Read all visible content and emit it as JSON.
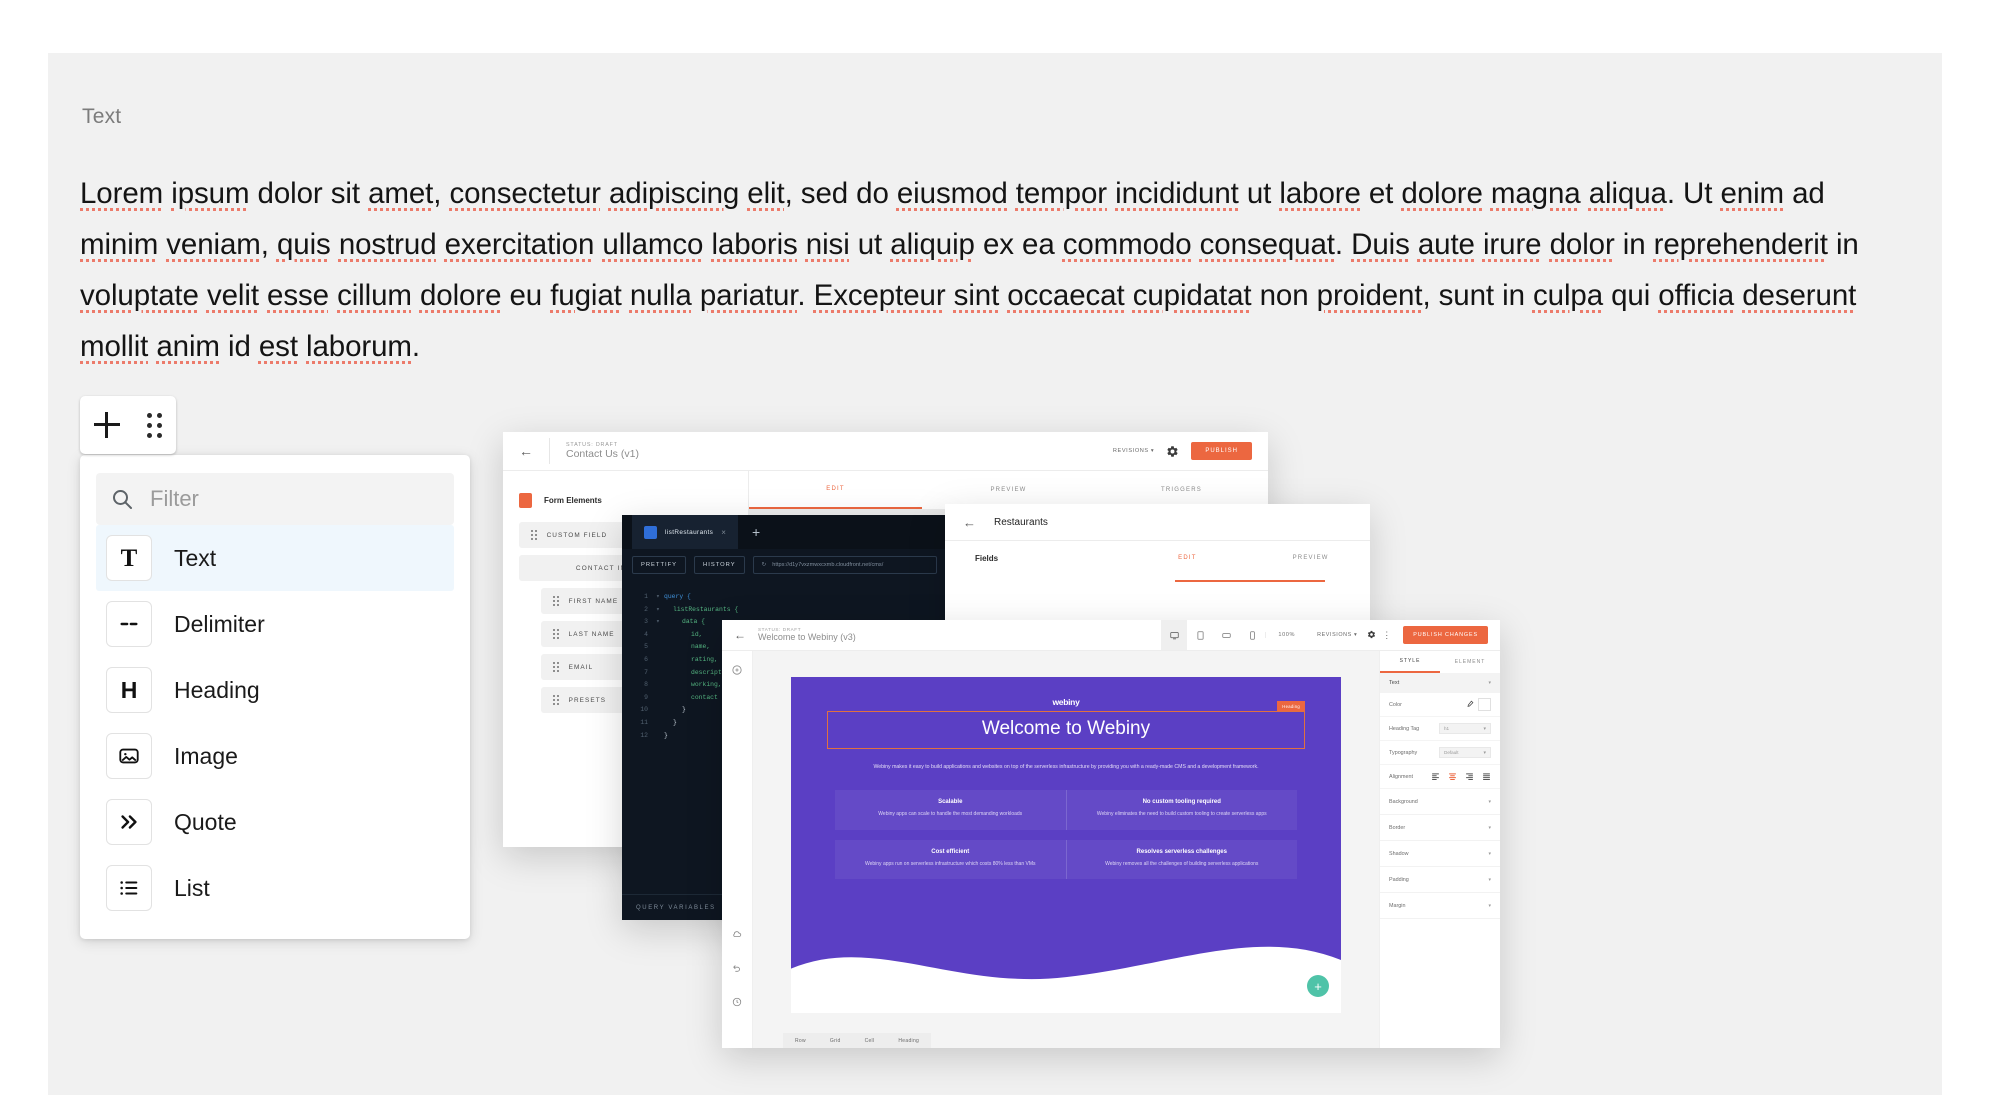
{
  "editor": {
    "block_label": "Text",
    "paragraph_words": [
      {
        "t": "Lorem",
        "sp": true
      },
      {
        "t": " "
      },
      {
        "t": "ipsum",
        "sp": true
      },
      {
        "t": " "
      },
      {
        "t": "dolor"
      },
      {
        "t": " "
      },
      {
        "t": "sit"
      },
      {
        "t": " "
      },
      {
        "t": "amet",
        "sp": true
      },
      {
        "t": ", "
      },
      {
        "t": "consectetur",
        "sp": true
      },
      {
        "t": " "
      },
      {
        "t": "adipiscing",
        "sp": true
      },
      {
        "t": " "
      },
      {
        "t": "elit",
        "sp": true
      },
      {
        "t": ", sed do "
      },
      {
        "t": "eiusmod",
        "sp": true
      },
      {
        "t": " "
      },
      {
        "t": "tempor",
        "sp": true
      },
      {
        "t": " "
      },
      {
        "t": "incididunt",
        "sp": true
      },
      {
        "t": " ut "
      },
      {
        "t": "labore",
        "sp": true
      },
      {
        "t": " et "
      },
      {
        "t": "dolore",
        "sp": true
      },
      {
        "t": " "
      },
      {
        "t": "magna",
        "sp": true
      },
      {
        "t": " "
      },
      {
        "t": "aliqua",
        "sp": true
      },
      {
        "t": ". Ut "
      },
      {
        "t": "enim",
        "sp": true
      },
      {
        "t": " ad "
      },
      {
        "t": "minim",
        "sp": true
      },
      {
        "t": " "
      },
      {
        "t": "veniam",
        "sp": true
      },
      {
        "t": ", "
      },
      {
        "t": "quis",
        "sp": true
      },
      {
        "t": " "
      },
      {
        "t": "nostrud",
        "sp": true
      },
      {
        "t": " "
      },
      {
        "t": "exercitation",
        "sp": true
      },
      {
        "t": " "
      },
      {
        "t": "ullamco",
        "sp": true
      },
      {
        "t": " "
      },
      {
        "t": "laboris",
        "sp": true
      },
      {
        "t": " "
      },
      {
        "t": "nisi",
        "sp": true
      },
      {
        "t": " ut "
      },
      {
        "t": "aliquip",
        "sp": true
      },
      {
        "t": " ex ea "
      },
      {
        "t": "commodo",
        "sp": true
      },
      {
        "t": " "
      },
      {
        "t": "consequat",
        "sp": true
      },
      {
        "t": ". "
      },
      {
        "t": "Duis",
        "sp": true
      },
      {
        "t": " "
      },
      {
        "t": "aute",
        "sp": true
      },
      {
        "t": " "
      },
      {
        "t": "irure",
        "sp": true
      },
      {
        "t": " "
      },
      {
        "t": "dolor",
        "sp": true
      },
      {
        "t": " in "
      },
      {
        "t": "reprehenderit",
        "sp": true
      },
      {
        "t": " "
      },
      {
        "t": "in"
      },
      {
        "t": " "
      },
      {
        "t": "voluptate",
        "sp": true
      },
      {
        "t": " "
      },
      {
        "t": "velit",
        "sp": true
      },
      {
        "t": " "
      },
      {
        "t": "esse",
        "sp": true
      },
      {
        "t": " "
      },
      {
        "t": "cillum",
        "sp": true
      },
      {
        "t": " "
      },
      {
        "t": "dolore",
        "sp": true
      },
      {
        "t": " eu "
      },
      {
        "t": "fugiat",
        "sp": true
      },
      {
        "t": " "
      },
      {
        "t": "nulla",
        "sp": true
      },
      {
        "t": " "
      },
      {
        "t": "pariatur",
        "sp": true
      },
      {
        "t": ". "
      },
      {
        "t": "Excepteur",
        "sp": true
      },
      {
        "t": " "
      },
      {
        "t": "sint",
        "sp": true
      },
      {
        "t": " "
      },
      {
        "t": "occaecat",
        "sp": true
      },
      {
        "t": " "
      },
      {
        "t": "cupidatat",
        "sp": true
      },
      {
        "t": " non "
      },
      {
        "t": "proident",
        "sp": true
      },
      {
        "t": ", sunt in "
      },
      {
        "t": "culpa",
        "sp": true
      },
      {
        "t": " qui "
      },
      {
        "t": "officia",
        "sp": true
      },
      {
        "t": " "
      },
      {
        "t": "deserunt",
        "sp": true
      },
      {
        "t": " "
      },
      {
        "t": "mollit",
        "sp": true
      },
      {
        "t": " "
      },
      {
        "t": "anim",
        "sp": true
      },
      {
        "t": " id "
      },
      {
        "t": "est",
        "sp": true
      },
      {
        "t": " "
      },
      {
        "t": "laborum",
        "sp": true
      },
      {
        "t": "."
      }
    ]
  },
  "add_bar": {
    "plus_label": "+",
    "drag_label": "drag-handle"
  },
  "block_picker": {
    "filter_placeholder": "Filter",
    "filter_value": "",
    "options": [
      {
        "label": "Text",
        "glyph": "T",
        "icon": "text-icon",
        "selected": true
      },
      {
        "label": "Delimiter",
        "glyph": "--",
        "icon": "delimiter-icon",
        "selected": false
      },
      {
        "label": "Heading",
        "glyph": "H",
        "icon": "heading-icon",
        "selected": false
      },
      {
        "label": "Image",
        "glyph": "",
        "icon": "image-icon",
        "selected": false
      },
      {
        "label": "Quote",
        "glyph": "»",
        "icon": "quote-icon",
        "selected": false
      },
      {
        "label": "List",
        "glyph": "",
        "icon": "list-icon",
        "selected": false
      }
    ]
  },
  "screenshots": {
    "form_editor": {
      "status": "STATUS: DRAFT",
      "title": "Contact Us",
      "version": "(v1)",
      "revisions": "REVISIONS",
      "publish": "PUBLISH",
      "sidebar_title": "Form Elements",
      "custom_field": "CUSTOM FIELD",
      "group_label": "CONTACT INFORMATION",
      "fields": [
        "FIRST NAME",
        "LAST NAME",
        "EMAIL",
        "PRESETS"
      ],
      "tabs": [
        "EDIT",
        "PREVIEW",
        "TRIGGERS"
      ],
      "active_tab": "EDIT"
    },
    "graphql": {
      "tab_name": "listRestaurants",
      "new_tab": "+",
      "prettify": "PRETTIFY",
      "history": "HISTORY",
      "url": "https://d1y7vxzmwxcxmb.cloudfront.net/cms/",
      "query_variables": "QUERY VARIABLES",
      "code": [
        {
          "n": "1",
          "fold": "▾",
          "text": "query {",
          "indent": 0,
          "kw": true
        },
        {
          "n": "2",
          "fold": "▾",
          "text": "listRestaurants {",
          "indent": 1,
          "fn": true
        },
        {
          "n": "3",
          "fold": "▾",
          "text": "data {",
          "indent": 2,
          "fn": true
        },
        {
          "n": "4",
          "fold": "",
          "text": "id,",
          "indent": 3,
          "fn": true
        },
        {
          "n": "5",
          "fold": "",
          "text": "name,",
          "indent": 3,
          "fn": true
        },
        {
          "n": "6",
          "fold": "",
          "text": "rating,",
          "indent": 3,
          "fn": true
        },
        {
          "n": "7",
          "fold": "",
          "text": "description,",
          "indent": 3,
          "fn": true
        },
        {
          "n": "8",
          "fold": "",
          "text": "working,",
          "indent": 3,
          "fn": true
        },
        {
          "n": "9",
          "fold": "",
          "text": "contact",
          "indent": 3,
          "fn": true
        },
        {
          "n": "10",
          "fold": "",
          "text": "}",
          "indent": 2
        },
        {
          "n": "11",
          "fold": "",
          "text": "}",
          "indent": 1
        },
        {
          "n": "12",
          "fold": "",
          "text": "}",
          "indent": 0
        }
      ]
    },
    "content_model": {
      "title": "Restaurants",
      "sidebar_label": "Fields",
      "tabs": [
        "EDIT",
        "PREVIEW"
      ],
      "active_tab": "EDIT"
    },
    "page_builder": {
      "status": "STATUS: DRAFT",
      "title": "Welcome to Webiny",
      "version": "(v3)",
      "zoom": "100%",
      "revisions": "REVISIONS",
      "publish": "PUBLISH CHANGES",
      "hero_logo": "webiny",
      "hero_heading": "Welcome to Webiny",
      "hero_tag": "Heading",
      "hero_sub": "Webiny makes it easy to build applications and websites on top of the serverless infrastructure by providing you with a ready-made CMS and a development framework.",
      "cards": [
        {
          "title": "Scalable",
          "body": "Webiny apps can scale to handle the most demanding workloads"
        },
        {
          "title": "No custom tooling required",
          "body": "Webiny eliminates the need to build custom tooling to create serverless apps"
        },
        {
          "title": "Cost efficient",
          "body": "Webiny apps run on serverless infrastructure which costs 80% less than VMs"
        },
        {
          "title": "Resolves serverless challenges",
          "body": "Webiny removes all the challenges of building serverless applications"
        }
      ],
      "breadcrumbs": [
        "Row",
        "Grid",
        "Cell",
        "Heading"
      ],
      "panel_tabs": [
        "STYLE",
        "ELEMENT"
      ],
      "panel_active_tab": "STYLE",
      "panel_section": "Text",
      "panel_rows": [
        {
          "label": "Color",
          "value": ""
        },
        {
          "label": "Heading Tag",
          "value": "h1"
        },
        {
          "label": "Typography",
          "value": "Default"
        },
        {
          "label": "Alignment",
          "value": ""
        }
      ],
      "panel_collapsibles": [
        "Background",
        "Border",
        "Shadow",
        "Padding",
        "Margin"
      ],
      "fab": "+"
    }
  },
  "colors": {
    "accent": "#ec6740",
    "spellcheck": "#ec7b6b",
    "selected_row": "#eff7fd",
    "hero": "#5b3fc4",
    "canvas": "#f1f1f1"
  }
}
